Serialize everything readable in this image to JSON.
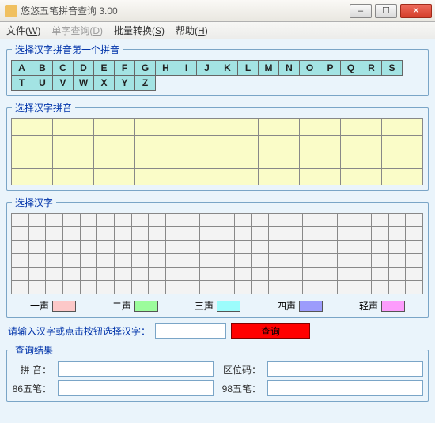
{
  "title": "悠悠五笔拼音查询 3.00",
  "menu": {
    "file": "文件(W)",
    "file_key": "W",
    "single": "单字查询(D)",
    "single_key": "D",
    "batch": "批量转换(S)",
    "batch_key": "S",
    "help": "帮助(H)",
    "help_key": "H"
  },
  "sections": {
    "letters": "选择汉字拼音第一个拼音",
    "pinyin": "选择汉字拼音",
    "hanzi": "选择汉字",
    "results": "查询结果"
  },
  "letters": [
    "A",
    "B",
    "C",
    "D",
    "E",
    "F",
    "G",
    "H",
    "I",
    "J",
    "K",
    "L",
    "M",
    "N",
    "O",
    "P",
    "Q",
    "R",
    "S",
    "T",
    "U",
    "V",
    "W",
    "X",
    "Y",
    "Z"
  ],
  "tones": [
    {
      "label": "一声",
      "color": "#fcc8c8"
    },
    {
      "label": "二声",
      "color": "#9cfc9c"
    },
    {
      "label": "三声",
      "color": "#9cfcfc"
    },
    {
      "label": "四声",
      "color": "#9c9cfc"
    },
    {
      "label": "轻声",
      "color": "#fc9cfc"
    }
  ],
  "inputrow": {
    "label": "请输入汉字或点击按钮选择汉字：",
    "value": "",
    "query_label": "查询"
  },
  "results": {
    "pinyin_label": "拼 音：",
    "pinyin_value": "",
    "quwei_label": "区位码：",
    "quwei_value": "",
    "wb86_label": "86五笔：",
    "wb86_value": "",
    "wb98_label": "98五笔：",
    "wb98_value": ""
  },
  "window_buttons": {
    "min": "–",
    "max": "☐",
    "close": "✕"
  }
}
